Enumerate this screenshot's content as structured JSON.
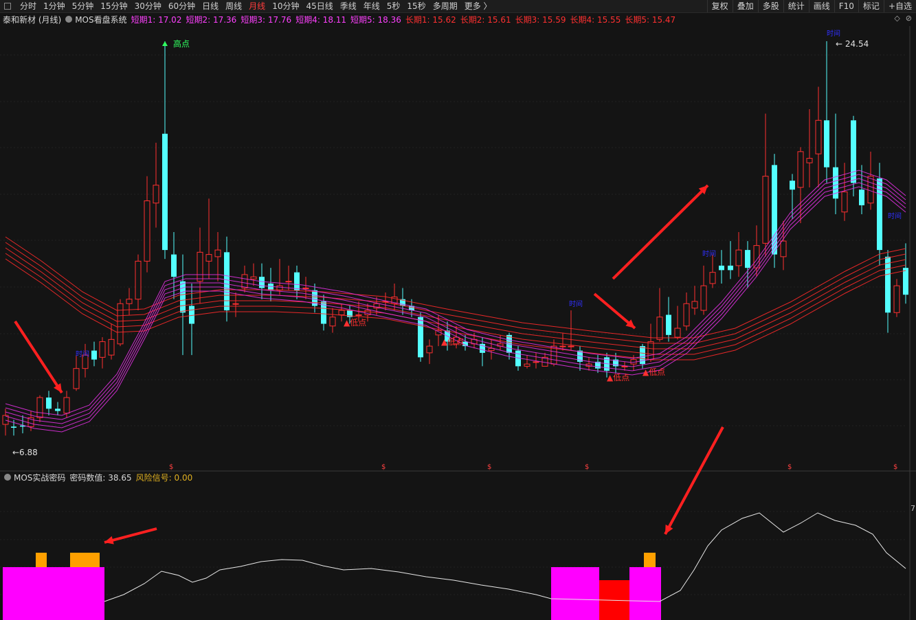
{
  "toolbar": {
    "tabs": [
      "分时",
      "1分钟",
      "5分钟",
      "15分钟",
      "30分钟",
      "60分钟",
      "日线",
      "周线",
      "月线",
      "10分钟",
      "45日线",
      "季线",
      "年线",
      "5秒",
      "15秒",
      "多周期",
      "更多 〉"
    ],
    "active_tab": "月线",
    "right_buttons": [
      "复权",
      "叠加",
      "多股",
      "统计",
      "画线",
      "F10",
      "标记",
      "+自选"
    ]
  },
  "header": {
    "stock": "泰和新材 (月线)",
    "indicator": "MOS看盘系统",
    "short_items": [
      "短期1: 17.02",
      "短期2: 17.36",
      "短期3: 17.76",
      "短期4: 18.11",
      "短期5: 18.36"
    ],
    "long_items": [
      "长期1: 15.62",
      "长期2: 15.61",
      "长期3: 15.59",
      "长期4: 15.55",
      "长期5: 15.47"
    ],
    "colors": {
      "short": "#ff40ff",
      "long": "#ff3030"
    }
  },
  "main_chart": {
    "high_label": "高点",
    "high_value": "24.54",
    "low_value": "6.88",
    "low_labels": [
      "低点",
      "低点",
      "低点",
      "低点"
    ],
    "dollar_mark": "$",
    "signal_text": "时间"
  },
  "sub_panel": {
    "indicator": "MOS实战密码",
    "value_text": "密码数值: 38.65",
    "risk_text": "风险信号: 0.00",
    "axis_label": "7"
  },
  "colors": {
    "up": "#ff3030",
    "down": "#54ffff",
    "bg": "#141414",
    "magenta": "#ff00ff",
    "orange": "#ffa000"
  }
}
